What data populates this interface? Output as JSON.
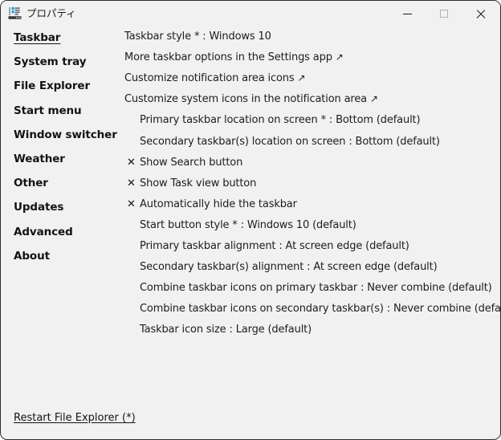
{
  "window": {
    "title": "プロパティ",
    "icon": "explorer-patcher-icon",
    "background_color": "#f1f1f1",
    "border_color": "#2b2b2b"
  },
  "titlebar": {
    "minimize_label": "—",
    "maximize_label": "□",
    "close_label": "✕",
    "maximize_disabled": true
  },
  "sidebar": {
    "items": [
      {
        "label": "Taskbar",
        "active": true
      },
      {
        "label": "System tray",
        "active": false
      },
      {
        "label": "File Explorer",
        "active": false
      },
      {
        "label": "Start menu",
        "active": false
      },
      {
        "label": "Window switcher",
        "active": false
      },
      {
        "label": "Weather",
        "active": false
      },
      {
        "label": "Other",
        "active": false
      },
      {
        "label": "Updates",
        "active": false
      },
      {
        "label": "Advanced",
        "active": false
      },
      {
        "label": "About",
        "active": false
      }
    ]
  },
  "main": {
    "rows": [
      {
        "label": "Taskbar style * : Windows 10",
        "type": "setting",
        "indent": false,
        "arrow": false,
        "check": null
      },
      {
        "label": "More taskbar options in the Settings app",
        "type": "link",
        "indent": false,
        "arrow": true,
        "check": null
      },
      {
        "label": "Customize notification area icons",
        "type": "link",
        "indent": false,
        "arrow": true,
        "check": null
      },
      {
        "label": "Customize system icons in the notification area",
        "type": "link",
        "indent": false,
        "arrow": true,
        "check": null
      },
      {
        "label": "Primary taskbar location on screen * : Bottom (default)",
        "type": "setting",
        "indent": true,
        "arrow": false,
        "check": null
      },
      {
        "label": "Secondary taskbar(s) location on screen : Bottom (default)",
        "type": "setting",
        "indent": true,
        "arrow": false,
        "check": null
      },
      {
        "label": "Show Search button",
        "type": "checkbox",
        "indent": true,
        "arrow": false,
        "check": "✕"
      },
      {
        "label": "Show Task view button",
        "type": "checkbox",
        "indent": true,
        "arrow": false,
        "check": "✕"
      },
      {
        "label": "Automatically hide the taskbar",
        "type": "checkbox",
        "indent": true,
        "arrow": false,
        "check": "✕"
      },
      {
        "label": "Start button style * : Windows 10 (default)",
        "type": "setting",
        "indent": true,
        "arrow": false,
        "check": null
      },
      {
        "label": "Primary taskbar alignment : At screen edge (default)",
        "type": "setting",
        "indent": true,
        "arrow": false,
        "check": null
      },
      {
        "label": "Secondary taskbar(s) alignment : At screen edge (default)",
        "type": "setting",
        "indent": true,
        "arrow": false,
        "check": null
      },
      {
        "label": "Combine taskbar icons on primary taskbar : Never combine (default)",
        "type": "setting",
        "indent": true,
        "arrow": false,
        "check": null
      },
      {
        "label": "Combine taskbar icons on secondary taskbar(s) : Never combine (default)",
        "type": "setting",
        "indent": true,
        "arrow": false,
        "check": null
      },
      {
        "label": "Taskbar icon size : Large (default)",
        "type": "setting",
        "indent": true,
        "arrow": false,
        "check": null
      }
    ],
    "external_arrow_glyph": "↗"
  },
  "footer": {
    "restart_link": "Restart File Explorer (*)"
  }
}
